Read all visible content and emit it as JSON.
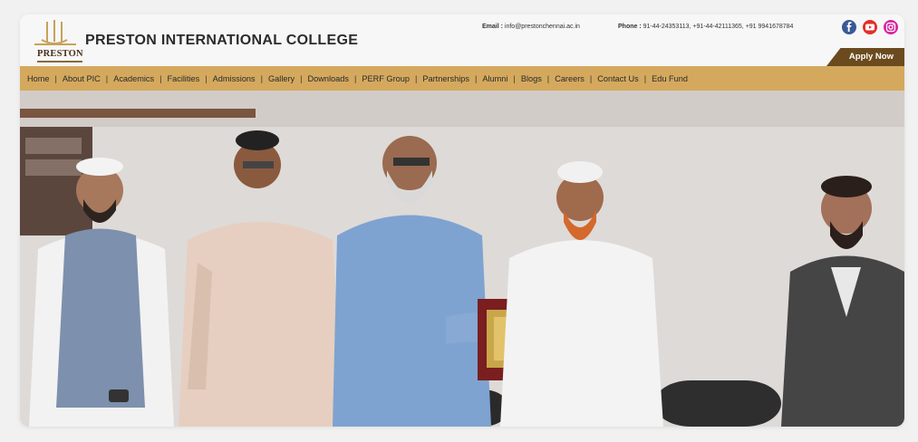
{
  "header": {
    "logo_text": "PRESTON",
    "college_name": "PRESTON INTERNATIONAL COLLEGE",
    "email_label": "Email :",
    "email_value": "info@prestonchennai.ac.in",
    "phone_label": "Phone :",
    "phone_value": "91-44-24353113, +91-44-42111365, +91 9941678784",
    "apply_label": "Apply Now"
  },
  "social": [
    {
      "icon": "facebook-icon"
    },
    {
      "icon": "youtube-icon"
    },
    {
      "icon": "instagram-icon"
    }
  ],
  "nav": {
    "items": [
      "Home",
      "About PIC",
      "Academics",
      "Facilities",
      "Admissions",
      "Gallery",
      "Downloads",
      "PERF Group",
      "Partnerships",
      "Alumni",
      "Blogs",
      "Careers",
      "Contact Us",
      "Edu Fund"
    ]
  },
  "hero": {
    "description_icon": "award-ceremony-photo"
  },
  "colors": {
    "nav_bg": "#d4a95e",
    "apply_bg": "#6b4a1e",
    "facebook": "#3b5998",
    "youtube": "#e52d27",
    "instagram": "#d6249f"
  }
}
